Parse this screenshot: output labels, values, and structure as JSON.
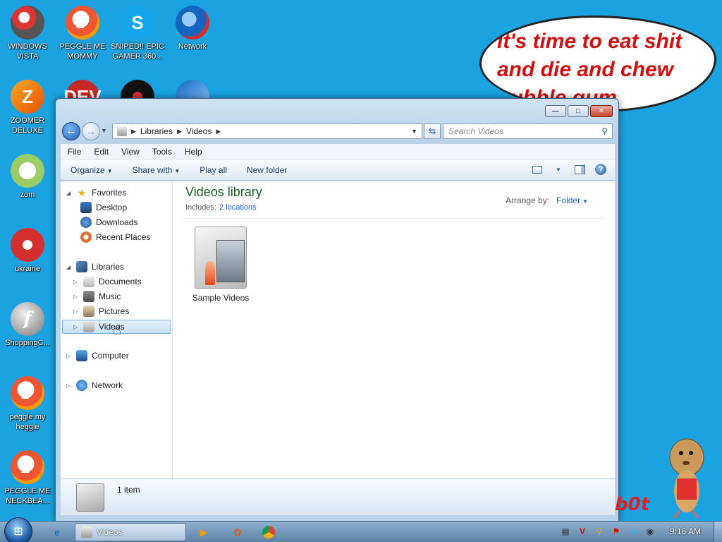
{
  "desktop": {
    "icons": [
      {
        "label": "WINDOWS VISTA",
        "glyph": ""
      },
      {
        "label": "PEGGLE ME MOMMY",
        "glyph": "P"
      },
      {
        "label": "SNIPED!! EPIC GAMER 360...",
        "glyph": "S"
      },
      {
        "label": "Network",
        "glyph": ""
      },
      {
        "label": "ZOOMER DELUXE",
        "glyph": "Z"
      },
      {
        "label": "zom",
        "glyph": ""
      },
      {
        "label": "ukraine",
        "glyph": ""
      },
      {
        "label": "ShoppingC...",
        "glyph": "f"
      },
      {
        "label": "peggle my heggle",
        "glyph": "P"
      },
      {
        "label": "PEGGLE ME NECKBEA...",
        "glyph": "P"
      },
      {
        "label": "",
        "glyph": "DEV"
      },
      {
        "label": "",
        "glyph": ""
      },
      {
        "label": "",
        "glyph": ""
      }
    ],
    "bubble_text": "it's time to eat shit and die and chew bubble gum",
    "watermark": "b0t"
  },
  "window": {
    "caption_buttons": {
      "minimize": "—",
      "maximize": "□",
      "close": "✕"
    },
    "breadcrumb": [
      "Libraries",
      "Videos"
    ],
    "search_placeholder": "Search Videos",
    "menu": [
      "File",
      "Edit",
      "View",
      "Tools",
      "Help"
    ],
    "commands": {
      "organize": "Organize",
      "share_with": "Share with",
      "play_all": "Play all",
      "new_folder": "New folder"
    },
    "nav_pane": {
      "favorites": "Favorites",
      "desktop": "Desktop",
      "downloads": "Downloads",
      "recent_places": "Recent Places",
      "libraries": "Libraries",
      "documents": "Documents",
      "music": "Music",
      "pictures": "Pictures",
      "videos": "Videos",
      "computer": "Computer",
      "network": "Network"
    },
    "content": {
      "title": "Videos library",
      "includes_label": "Includes:",
      "includes_link": "2 locations",
      "arrange_label": "Arrange by:",
      "arrange_value": "Folder",
      "items": [
        {
          "label": "Sample Videos"
        }
      ]
    },
    "details": {
      "count": "1 item"
    }
  },
  "taskbar": {
    "active_window_label": "Videos",
    "clock": "9:16 AM"
  },
  "colors": {
    "desktop_bg": "#1aa3e0",
    "library_title": "#1e5e2a",
    "link": "#1f5eb5",
    "bubble_text": "#d01010"
  }
}
